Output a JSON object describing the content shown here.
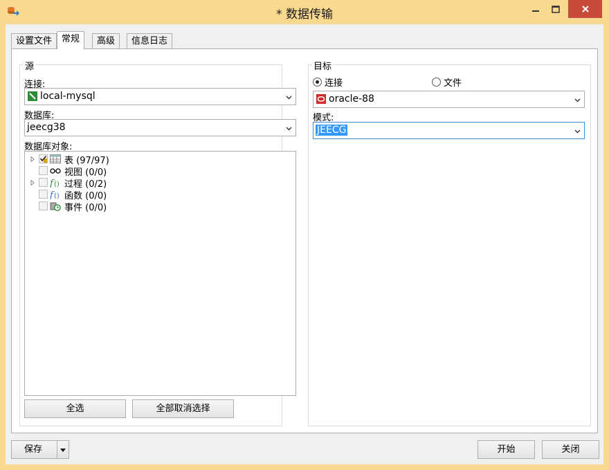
{
  "window": {
    "title": "* 数据传输"
  },
  "tabs": [
    {
      "label": "设置文件"
    },
    {
      "label": "常规"
    },
    {
      "label": "高级"
    },
    {
      "label": "信息日志"
    }
  ],
  "source": {
    "group_title": "源",
    "connection_label": "连接:",
    "connection_value": "local-mysql",
    "database_label": "数据库:",
    "database_value": "jeecg38",
    "objects_label": "数据库对象:",
    "tree": [
      {
        "label": "表",
        "count": "(97/97)",
        "icon": "table-icon",
        "checked": "partial",
        "expandable": true
      },
      {
        "label": "视图",
        "count": "(0/0)",
        "icon": "view-icon",
        "checked": "none",
        "expandable": false
      },
      {
        "label": "过程",
        "count": "(0/2)",
        "icon": "procedure-icon",
        "checked": "none",
        "expandable": true
      },
      {
        "label": "函数",
        "count": "(0/0)",
        "icon": "function-icon",
        "checked": "none",
        "expandable": false
      },
      {
        "label": "事件",
        "count": "(0/0)",
        "icon": "event-icon",
        "checked": "none",
        "expandable": false
      }
    ],
    "select_all_label": "全选",
    "deselect_all_label": "全部取消选择"
  },
  "target": {
    "group_title": "目标",
    "radio_connection_label": "连接",
    "radio_file_label": "文件",
    "selected_mode": "connection",
    "connection_value": "oracle-88",
    "schema_label": "模式:",
    "schema_value": "JEECG"
  },
  "footer": {
    "save_label": "保存",
    "start_label": "开始",
    "close_label": "关闭"
  },
  "colors": {
    "title_bar": "#f8d98f",
    "close_button": "#c74a3b",
    "selection": "#3399ff",
    "mysql_icon": "#2e8b3a",
    "oracle_icon": "#d12c2c"
  }
}
